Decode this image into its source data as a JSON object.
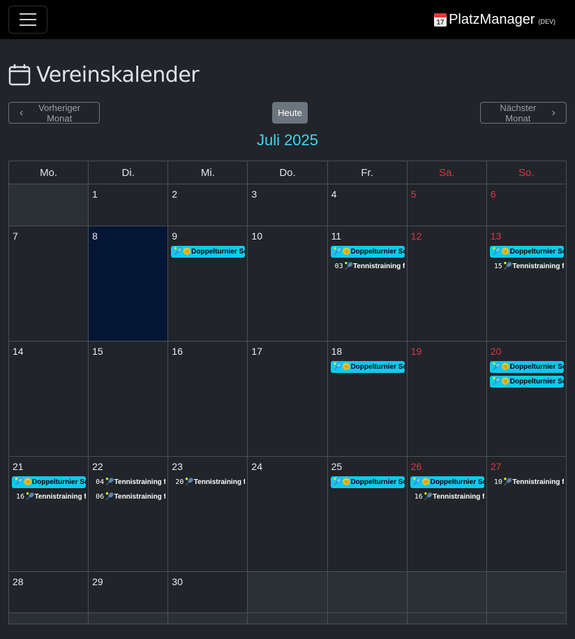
{
  "navbar": {
    "menu_icon": "hamburger-icon",
    "brand_icon": "calendar-icon",
    "brand": "PlatzManager",
    "env": "(DEV)"
  },
  "page": {
    "title_icon": "calendar-icon",
    "title": "Vereinskalender"
  },
  "controls": {
    "prev_label": "Vorheriger Monat",
    "today_label": "Heute",
    "next_label": "Nächster Monat"
  },
  "calendar": {
    "month_title": "Juli 2025",
    "weekdays": [
      "Mo.",
      "Di.",
      "Mi.",
      "Do.",
      "Fr.",
      "Sa.",
      "So."
    ],
    "events": {
      "doppel": "🎾🌞Doppelturnier Sommer",
      "training": "🎾Tennistraining für"
    },
    "times": {
      "t03": "03",
      "t15": "15",
      "t16": "16",
      "t04": "04",
      "t06": "06",
      "t20": "20",
      "t10": "10"
    },
    "days": {
      "d1": "1",
      "d2": "2",
      "d3": "3",
      "d4": "4",
      "d5": "5",
      "d6": "6",
      "d7": "7",
      "d8": "8",
      "d9": "9",
      "d10": "10",
      "d11": "11",
      "d12": "12",
      "d13": "13",
      "d14": "14",
      "d15": "15",
      "d16": "16",
      "d17": "17",
      "d18": "18",
      "d19": "19",
      "d20": "20",
      "d21": "21",
      "d22": "22",
      "d23": "23",
      "d24": "24",
      "d25": "25",
      "d26": "26",
      "d27": "27",
      "d28": "28",
      "d29": "29",
      "d30": "30"
    }
  },
  "colors": {
    "accent": "#0dcaf0",
    "weekend": "#dc3545",
    "today_bg": "#031633",
    "background": "#212529"
  }
}
